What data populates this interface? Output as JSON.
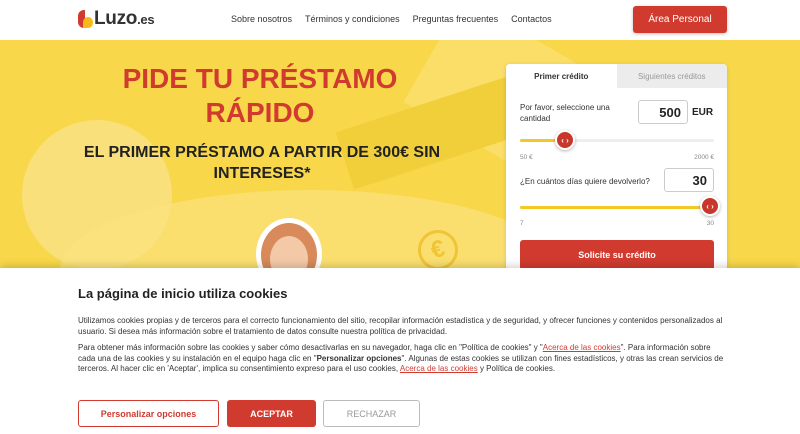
{
  "brand": {
    "name": "Luzo",
    "tld": ".es"
  },
  "nav": {
    "items": [
      {
        "label": "Sobre nosotros"
      },
      {
        "label": "Términos y condiciones"
      },
      {
        "label": "Preguntas frecuentes"
      },
      {
        "label": "Contactos"
      }
    ],
    "area_personal": "Área Personal"
  },
  "hero": {
    "headline_1": "PIDE TU PRÉSTAMO",
    "headline_2": "RÁPIDO",
    "subline_1": "EL PRIMER PRÉSTAMO A PARTIR DE 300€ SIN",
    "subline_2": "INTERESES*",
    "euro_symbol": "€"
  },
  "calculator": {
    "tabs": [
      {
        "label": "Primer crédito",
        "active": true
      },
      {
        "label": "Siguientes créditos",
        "active": false
      }
    ],
    "amount_label": "Por favor, seleccione una cantidad",
    "amount_value": "500",
    "amount_unit": "EUR",
    "amount_min": "50 €",
    "amount_max": "2000 €",
    "amount_fraction": 0.23,
    "days_label": "¿En cuántos días quiere devolverlo?",
    "days_value": "30",
    "days_min": "7",
    "days_max": "30",
    "days_fraction": 1.0,
    "knob_glyph": "‹ ›",
    "submit": "Solicite su crédito"
  },
  "cookies": {
    "title": "La página de inicio utiliza cookies",
    "p1": "Utilizamos cookies propias y de terceros para el correcto funcionamiento del sitio, recopilar información estadística y de seguridad, y ofrecer funciones y contenidos personalizados al usuario. Si desea más información sobre el tratamiento de datos consulte nuestra política de privacidad.",
    "p2_a": "Para obtener más información sobre las cookies y saber cómo desactivarlas en su navegador, haga clic en \"Política de cookies\" y \"",
    "p2_link1": "Acerca de las cookies",
    "p2_b": "\". Para información sobre cada una de las cookies y su instalación en el equipo haga clic en \"",
    "p2_bold": "Personalizar opciones",
    "p2_c": "\". Algunas de estas cookies se utilizan con fines estadísticos, y otras las crean servicios de terceros. Al hacer clic en 'Aceptar', implica su consentimiento expreso para el uso cookies, ",
    "p2_link2": "Acerca de las cookies",
    "p2_d": " y Política de cookies.",
    "btn_personalize": "Personalizar opciones",
    "btn_accept": "ACEPTAR",
    "btn_reject": "RECHAZAR"
  },
  "colors": {
    "accent": "#d13b2f",
    "hero_bg": "#f8d84a",
    "slider_fill": "#f5c82a"
  }
}
